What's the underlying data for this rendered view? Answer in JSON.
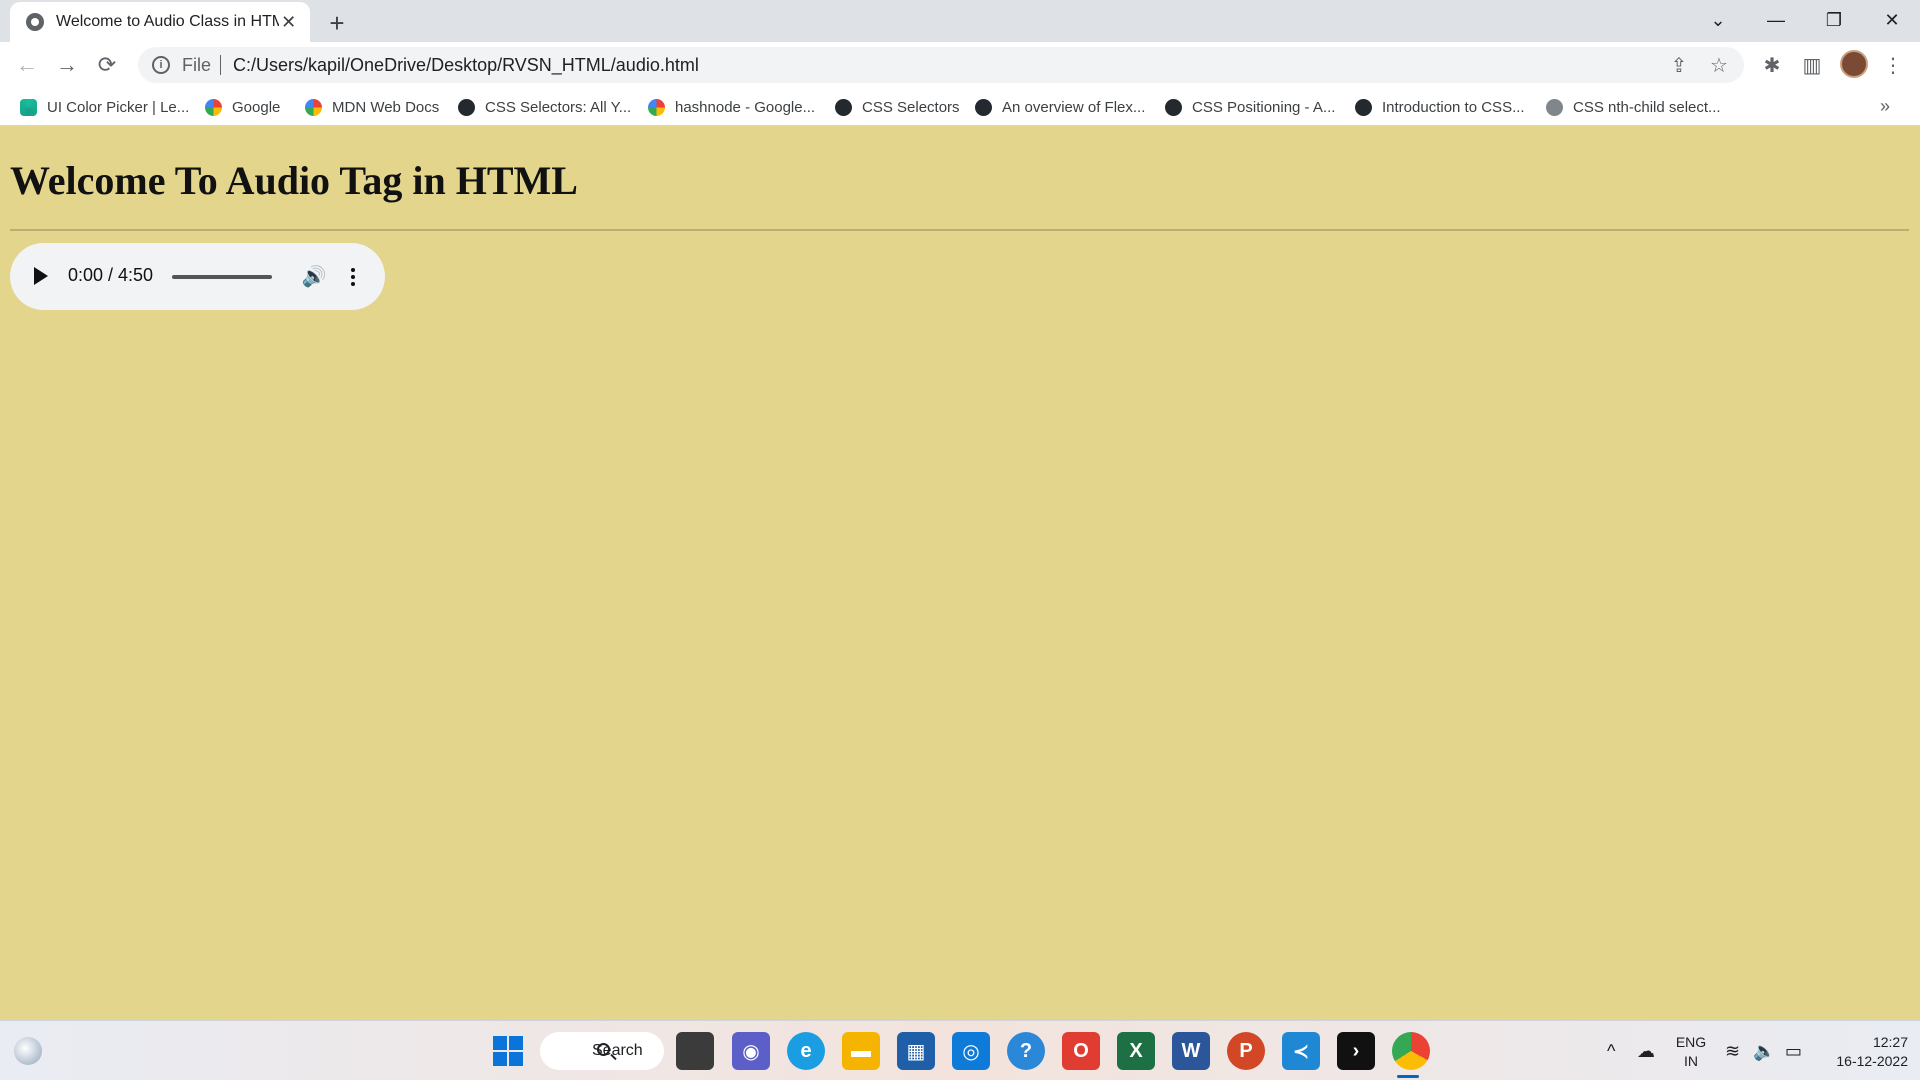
{
  "browser": {
    "tab": {
      "title": "Welcome to Audio Class in HTML",
      "close": "✕"
    },
    "new_tab": "+",
    "window_controls": {
      "dropdown": "⌄",
      "minimize": "—",
      "restore": "❐",
      "close": "✕"
    },
    "nav": {
      "back": "←",
      "forward": "→",
      "reload": "⟳"
    },
    "omnibox": {
      "info": "i",
      "scheme_label": "File",
      "url": "C:/Users/kapil/OneDrive/Desktop/RVSN_HTML/audio.html"
    },
    "toolbar_icons": {
      "share": "⇪",
      "star": "☆",
      "extensions": "✱",
      "sidepanel": "▥",
      "menu": "⋮"
    },
    "bookmarks": [
      {
        "label": "UI Color Picker | Le...",
        "icon": "color-picker-icon"
      },
      {
        "label": "Google",
        "icon": "google-icon"
      },
      {
        "label": "MDN Web Docs",
        "icon": "google-icon"
      },
      {
        "label": "CSS Selectors: All Y...",
        "icon": "github-icon"
      },
      {
        "label": "hashnode - Google...",
        "icon": "google-icon"
      },
      {
        "label": "CSS Selectors",
        "icon": "github-icon"
      },
      {
        "label": "An overview of Flex...",
        "icon": "github-icon"
      },
      {
        "label": "CSS Positioning - A...",
        "icon": "github-icon"
      },
      {
        "label": "Introduction to CSS...",
        "icon": "github-icon"
      },
      {
        "label": "CSS nth-child select...",
        "icon": "globe-icon"
      }
    ],
    "bookmarks_more": "»"
  },
  "page": {
    "background_color": "#e3d58c",
    "heading": "Welcome To Audio Tag in HTML",
    "audio_player": {
      "time": "0:00 / 4:50",
      "progress": 0,
      "volume_icon": "🔊"
    }
  },
  "taskbar": {
    "search_label": "Search",
    "apps": [
      "start-icon",
      "task-view-icon",
      "teams-icon",
      "edge-icon",
      "file-explorer-icon",
      "store-icon",
      "app-icon",
      "help-icon",
      "office-icon",
      "excel-icon",
      "word-icon",
      "powerpoint-icon",
      "vscode-icon",
      "terminal-icon",
      "chrome-icon"
    ],
    "tray": {
      "chevron": "^",
      "cloud": "☁",
      "wifi": "≋",
      "volume": "🔈",
      "battery": "▭"
    },
    "language": {
      "line1": "ENG",
      "line2": "IN"
    },
    "clock": {
      "time": "12:27",
      "date": "16-12-2022"
    }
  }
}
